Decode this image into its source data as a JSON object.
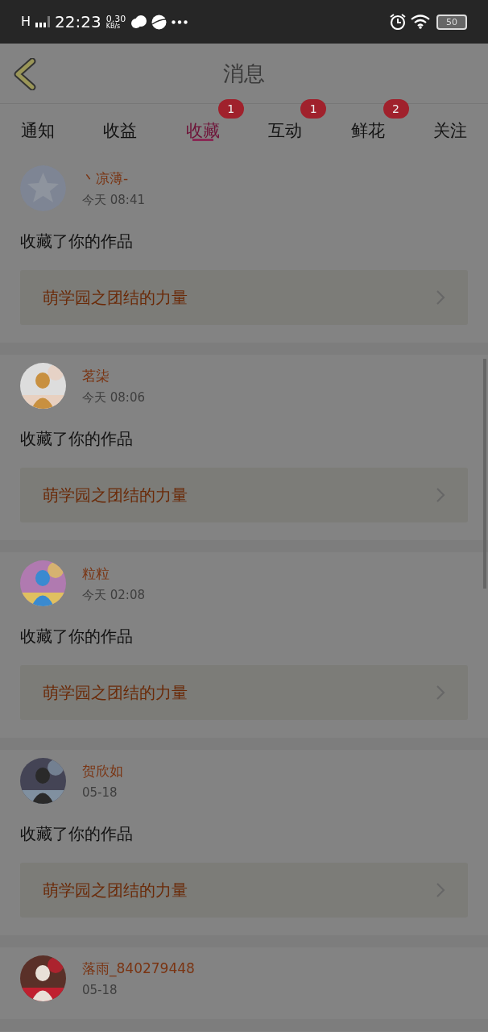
{
  "status_bar": {
    "network": "H",
    "time": "22:23",
    "speed": "0.30",
    "speed_unit": "KB/s",
    "battery": "50"
  },
  "header": {
    "title": "消息"
  },
  "tabs": [
    {
      "label": "通知",
      "selected": false
    },
    {
      "label": "收益",
      "selected": false
    },
    {
      "label": "收藏",
      "selected": true,
      "badge": "1"
    },
    {
      "label": "互动",
      "selected": false,
      "badge": "1"
    },
    {
      "label": "鲜花",
      "selected": false,
      "badge": "2"
    },
    {
      "label": "关注",
      "selected": false
    }
  ],
  "messages": [
    {
      "kind": "default",
      "name": "丶凉薄-",
      "time": "今天  08:41",
      "text": "收藏了你的作品",
      "work": "萌学园之团结的力量"
    },
    {
      "kind": "picture",
      "name": "茗柒",
      "time": "今天  08:06",
      "text": "收藏了你的作品",
      "work": "萌学园之团结的力量"
    },
    {
      "kind": "picture",
      "name": "粒粒",
      "time": "今天  02:08",
      "text": "收藏了你的作品",
      "work": "萌学园之团结的力量"
    },
    {
      "kind": "picture",
      "name": "贺欣如",
      "time": "05-18",
      "text": "收藏了你的作品",
      "work": "萌学园之团结的力量"
    },
    {
      "kind": "picture",
      "name": "落雨_840279448",
      "time": "05-18"
    }
  ]
}
